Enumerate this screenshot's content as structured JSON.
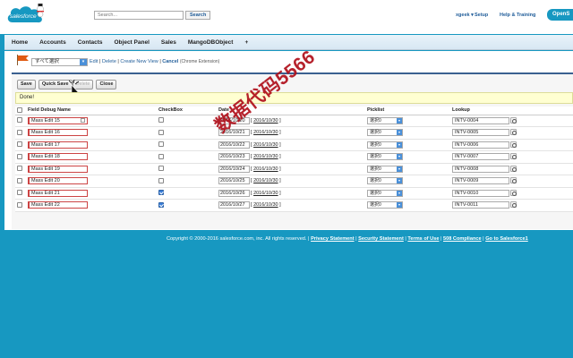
{
  "header": {
    "logo_text": "salesforce",
    "search_placeholder": "Search...",
    "search_button": "Search",
    "user_menu": "xgeek",
    "user_menu_arrow": "▾",
    "setup": "Setup",
    "help": "Help & Training",
    "app_button": "OpenS"
  },
  "nav": {
    "tabs": [
      "Home",
      "Accounts",
      "Contacts",
      "Object Panel",
      "Sales",
      "MangoDBObject",
      "+"
    ]
  },
  "view": {
    "select_value": "すべて選択",
    "links": [
      "Edit",
      "Delete",
      "Create New View",
      "Cancel"
    ],
    "note": "(Chrome Extension)"
  },
  "buttons": {
    "save": "Save",
    "quick_save": "Quick Save",
    "delete": "Delete",
    "close": "Close"
  },
  "message": "Done!",
  "table": {
    "headers": [
      "Field Debug Name",
      "CheckBox",
      "Date",
      "Picklist",
      "Lookup"
    ],
    "rows": [
      {
        "name": "Mass Edit 15",
        "checked": false,
        "date": "2016/10/20",
        "date_link": "2016/10/30",
        "picklist": "選択0",
        "lookup": "INTV-0004"
      },
      {
        "name": "Mass Edit 16",
        "checked": false,
        "date": "2016/10/21",
        "date_link": "2016/10/30",
        "picklist": "選択0",
        "lookup": "INTV-0005"
      },
      {
        "name": "Mass Edit 17",
        "checked": false,
        "date": "2016/10/22",
        "date_link": "2016/10/30",
        "picklist": "選択0",
        "lookup": "INTV-0006"
      },
      {
        "name": "Mass Edit 18",
        "checked": false,
        "date": "2016/10/23",
        "date_link": "2016/10/30",
        "picklist": "選択0",
        "lookup": "INTV-0007"
      },
      {
        "name": "Mass Edit 19",
        "checked": false,
        "date": "2016/10/24",
        "date_link": "2016/10/30",
        "picklist": "選択0",
        "lookup": "INTV-0008"
      },
      {
        "name": "Mass Edit 20",
        "checked": false,
        "date": "2016/10/25",
        "date_link": "2016/10/30",
        "picklist": "選択0",
        "lookup": "INTV-0009"
      },
      {
        "name": "Mass Edit 21",
        "checked": true,
        "date": "2016/10/26",
        "date_link": "2016/10/30",
        "picklist": "選択0",
        "lookup": "INTV-0010"
      },
      {
        "name": "Mass Edit 22",
        "checked": true,
        "date": "2016/10/27",
        "date_link": "2016/10/30",
        "picklist": "選択0",
        "lookup": "INTV-0011"
      }
    ]
  },
  "watermark": "数据代码5566",
  "footer": {
    "copyright": "Copyright © 2000-2016 salesforce.com, inc. All rights reserved.",
    "links": [
      "Privacy Statement",
      "Security Statement",
      "Terms of Use",
      "508 Compliance",
      "Go to Salesforce1"
    ]
  },
  "colors": {
    "brand": "#1798c1",
    "link": "#1f5c99",
    "watermark": "#b0101b"
  }
}
